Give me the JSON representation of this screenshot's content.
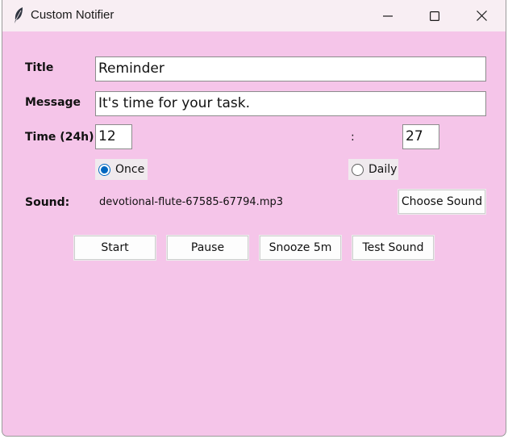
{
  "window": {
    "title": "Custom Notifier",
    "background": "#f5c5e9",
    "controls": [
      "minimize-icon",
      "maximize-icon",
      "close-icon"
    ]
  },
  "form": {
    "title_label": "Title",
    "title_value": "Reminder",
    "message_label": "Message",
    "message_value": "It's time for your task.",
    "time_label": "Time (24h)",
    "hour_value": "12",
    "time_separator": ":",
    "minute_value": "27",
    "repeat": {
      "options": [
        "Once",
        "Daily"
      ],
      "selected": "Once"
    },
    "sound_label": "Sound:",
    "sound_file": "devotional-flute-67585-67794.mp3",
    "choose_sound_label": "Choose Sound"
  },
  "actions": {
    "start_label": "Start",
    "pause_label": "Pause",
    "snooze_label": "Snooze 5m",
    "test_sound_label": "Test Sound"
  },
  "colors": {
    "accent": "#0067c0",
    "titlebar": "#f8eef3"
  }
}
